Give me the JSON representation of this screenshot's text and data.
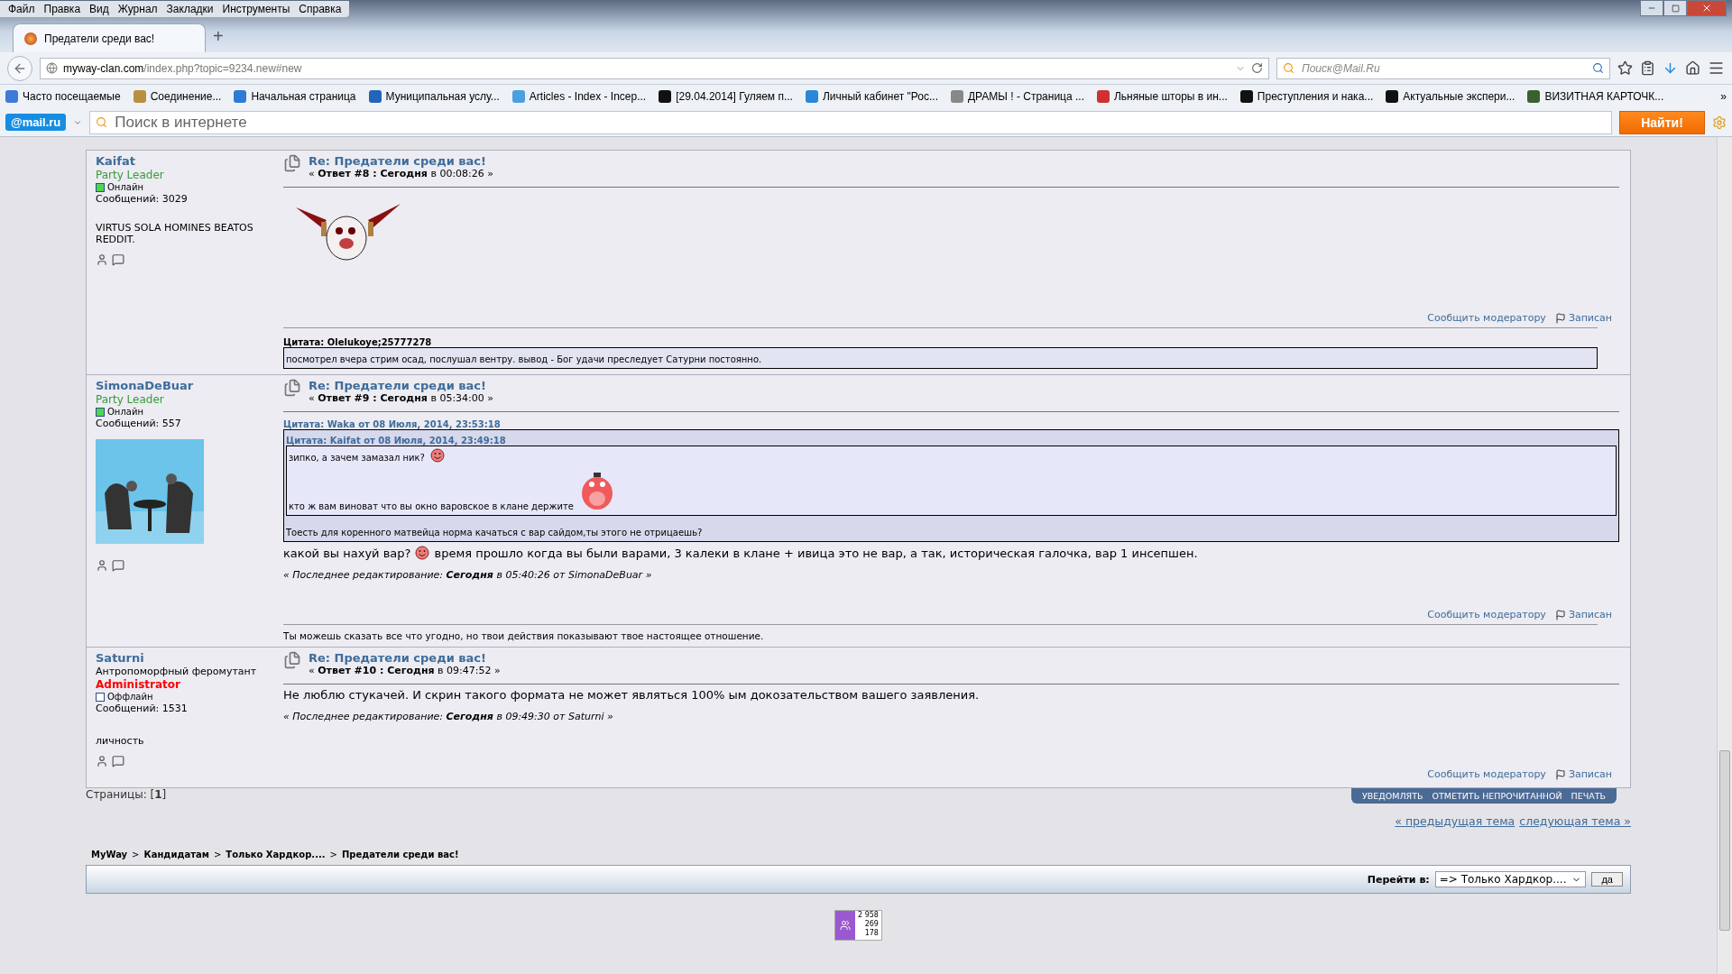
{
  "menu_bar": [
    "Файл",
    "Правка",
    "Вид",
    "Журнал",
    "Закладки",
    "Инструменты",
    "Справка"
  ],
  "tabs": [
    {
      "title": "Предатели среди вас!",
      "selected": true
    }
  ],
  "new_tab": "+",
  "address_bar": {
    "host": "myway-clan.com",
    "path": "/index.php?topic=9234.new#new"
  },
  "search_box": {
    "placeholder": "Поиск@Mail.Ru"
  },
  "bookmarks": [
    "Часто посещаемые",
    "Соединение...",
    "Начальная страница",
    "Муниципальная услу...",
    "Articles - Index - Incep...",
    "[29.04.2014] Гуляем п...",
    "Личный кабинет \"Рос...",
    "ДРАМЫ ! - Страница ...",
    "Льняные шторы в ин...",
    "Преступления и нака...",
    "Актуальные экспери...",
    "ВИЗИТНАЯ КАРТОЧК..."
  ],
  "bookmarks_overflow": "»",
  "mail_bar": {
    "logo": "@mail.ru",
    "placeholder": "Поиск в интернете",
    "button": "Найти!"
  },
  "posts": [
    {
      "author": "Kaifat",
      "rank": {
        "label": "Party Leader",
        "kind": "member",
        "color": "#3a9a3a"
      },
      "online": true,
      "status": "Онлайн",
      "post_count": "Сообщений: 3029",
      "personal_text": "VIRTUS SOLA HOMINES BEATOS REDDIT.",
      "subject": "Re: Предатели среди вас!",
      "meta": "« **Ответ #8 : Сегодня** в 00:08:26 »",
      "content": [
        {
          "kind": "drawing"
        }
      ],
      "report": "Сообщить модератору",
      "logged": "Записан",
      "signature": [
        {
          "kind": "quote",
          "header": "Цитата: Olelukoye;25777278",
          "lines": [
            {
              "text": "посмотрел вчера стрим осад, послушал вентру. вывод - Бог удачи преследует Сатурни постоянно."
            }
          ]
        }
      ]
    },
    {
      "author": "SimonaDeBuar",
      "rank": {
        "label": "Party Leader",
        "kind": "member",
        "color": "#3a9a3a"
      },
      "online": true,
      "status": "Онлайн",
      "post_count": "Сообщений: 557",
      "avatar": {
        "kind": "picture"
      },
      "subject": "Re: Предатели среди вас!",
      "meta": "« **Ответ #9 : Сегодня** в 05:34:00 »",
      "content": [
        {
          "kind": "quote",
          "header": "Цитата: Waka от 08 Июля, 2014, 23:53:18",
          "quote": {
            "header": "Цитата: Kaifat от 08 Июля, 2014, 23:49:18",
            "lines": [
              {
                "text": "зипко, а зачем замазал ник?",
                "kind": "smiley"
              },
              {
                "text": "кто ж вам виноват что вы окно варовское в клане держите",
                "kind": "creature"
              }
            ]
          },
          "lines": [
            {
              "text": "Тоесть для коренного матвейца норма качаться с вар сайдом,ты этого не отрицаешь?"
            }
          ]
        },
        {
          "kind": "text",
          "segments": [
            "какой вы нахуй вар?",
            "время прошло когда вы были варами, 3 калеки в клане + ивица это не вар, а так, историческая галочка, вар 1 инсепшен."
          ]
        }
      ],
      "edit_note": "« Последнее редактирование: **Сегодня** в 05:40:26 от SimonaDeBuar »",
      "report": "Сообщить модератору",
      "logged": "Записан",
      "signature": [
        {
          "kind": "text",
          "segments": [
            "Ты можешь сказать все что угодно, но твои действия показывают твое настоящее отношение."
          ]
        }
      ]
    },
    {
      "author": "Saturni",
      "custom_title": "Антропоморфный феромутант",
      "rank": {
        "label": "Administrator",
        "kind": "admin",
        "color": "#ff0000"
      },
      "online": false,
      "status": "Оффлайн",
      "post_count": "Сообщений: 1531",
      "personal_text": "личность",
      "subject": "Re: Предатели среди вас!",
      "meta": "« **Ответ #10 : Сегодня** в 09:47:52 »",
      "content": [
        {
          "kind": "text",
          "segments": [
            "Не люблю стукачей. И скрин такого формата не может являться 100% ым докозательством вашего заявления."
          ]
        }
      ],
      "edit_note": "« Последнее редактирование: **Сегодня** в 09:49:30 от Saturni »",
      "report": "Сообщить модератору",
      "logged": "Записан"
    }
  ],
  "pages": "Страницы: [**1**]",
  "topic_buttons": [
    "УВЕДОМЛЯТЬ",
    "ОТМЕТИТЬ НЕПРОЧИТАННОЙ",
    "ПЕЧАТЬ"
  ],
  "topic_nav": [
    "« предыдущая тема",
    "следующая тема »"
  ],
  "breadcrumb": {
    "separator": ">",
    "items": [
      "MyWay",
      "Кандидатам",
      "Только Хардкор....",
      "Предатели среди вас!"
    ]
  },
  "jump": {
    "label": "Перейти в:",
    "value": "=> Только Хардкор....",
    "button": "да"
  },
  "counter": [
    "2 958",
    "269",
    "178"
  ]
}
